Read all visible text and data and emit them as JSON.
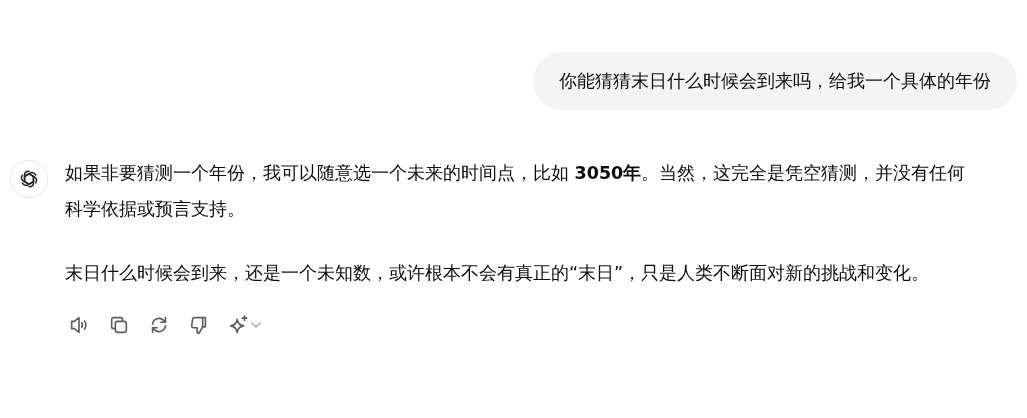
{
  "user_message": "你能猜猜末日什么时候会到来吗，给我一个具体的年份",
  "assistant_message": {
    "paragraphs": [
      "如果非要猜测一个年份，我可以随意选一个未来的时间点，比如 **3050年**。当然，这完全是凭空猜测，并没有任何科学依据或预言支持。",
      "末日什么时候会到来，还是一个未知数，或许根本不会有真正的“末日”，只是人类不断面对新的挑战和变化。"
    ],
    "actions": [
      {
        "kind": "speaker"
      },
      {
        "kind": "copy"
      },
      {
        "kind": "regenerate"
      },
      {
        "kind": "dislike"
      },
      {
        "kind": "sparkle"
      }
    ]
  }
}
